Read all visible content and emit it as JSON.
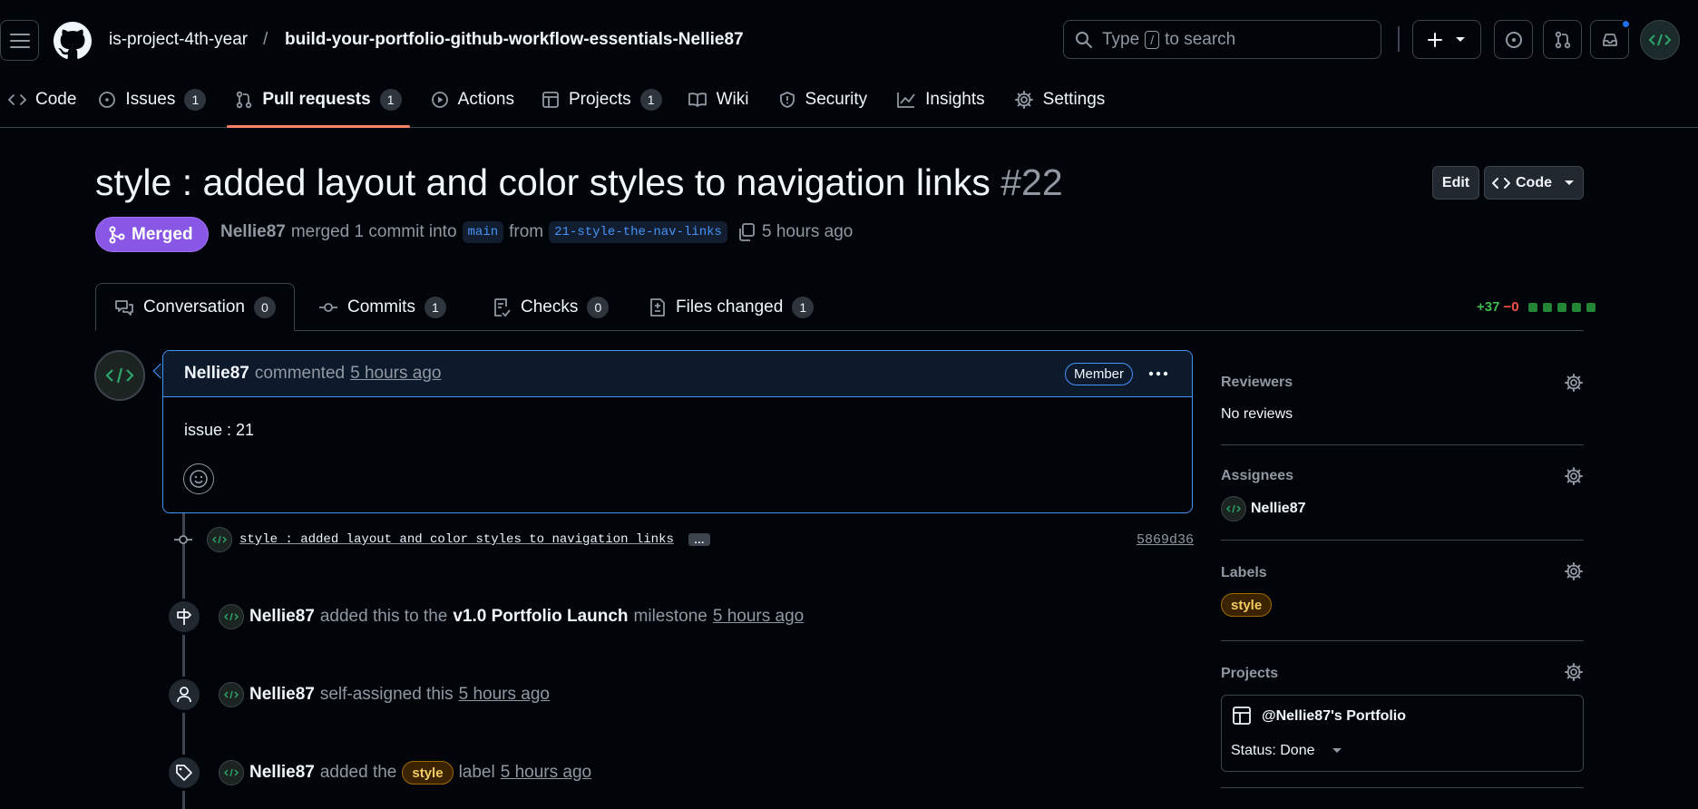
{
  "header": {
    "owner": "is-project-4th-year",
    "separator": "/",
    "repo": "build-your-portfolio-github-workflow-essentials-Nellie87",
    "search_prefix": "Type",
    "search_key": "/",
    "search_suffix": "to search"
  },
  "repo_tabs": [
    {
      "label": "Code",
      "icon": "code-icon",
      "count": null
    },
    {
      "label": "Issues",
      "icon": "issue-icon",
      "count": "1"
    },
    {
      "label": "Pull requests",
      "icon": "pull-request-icon",
      "count": "1",
      "active": true
    },
    {
      "label": "Actions",
      "icon": "play-icon",
      "count": null
    },
    {
      "label": "Projects",
      "icon": "table-icon",
      "count": "1"
    },
    {
      "label": "Wiki",
      "icon": "book-icon",
      "count": null
    },
    {
      "label": "Security",
      "icon": "shield-icon",
      "count": null
    },
    {
      "label": "Insights",
      "icon": "graph-icon",
      "count": null
    },
    {
      "label": "Settings",
      "icon": "gear-icon",
      "count": null
    }
  ],
  "pr": {
    "title": "style : added layout and color styles to navigation links",
    "number": "#22",
    "status": "Merged",
    "author": "Nellie87",
    "merged_text": "merged 1 commit into",
    "base_branch": "main",
    "from_text": "from",
    "head_branch": "21-style-the-nav-links",
    "time": "5 hours ago",
    "edit_label": "Edit",
    "code_label": "Code"
  },
  "pr_tabs": [
    {
      "label": "Conversation",
      "icon": "comment-icon",
      "count": "0"
    },
    {
      "label": "Commits",
      "icon": "commit-icon",
      "count": "1"
    },
    {
      "label": "Checks",
      "icon": "checklist-icon",
      "count": "0"
    },
    {
      "label": "Files changed",
      "icon": "file-diff-icon",
      "count": "1"
    }
  ],
  "diffstat": {
    "additions": "+37",
    "deletions": "−0",
    "blocks": 5
  },
  "comment": {
    "author": "Nellie87",
    "action": "commented",
    "time": "5 hours ago",
    "badge": "Member",
    "body": "issue : 21"
  },
  "commit": {
    "message": "style : added layout and color styles to navigation links",
    "ellipsis": "…",
    "sha": "5869d36"
  },
  "events": [
    {
      "author": "Nellie87",
      "pre": "added this to the",
      "strong": "v1.0 Portfolio Launch",
      "post": "milestone",
      "time": "5 hours ago"
    },
    {
      "author": "Nellie87",
      "pre": "self-assigned this",
      "time": "5 hours ago"
    },
    {
      "author": "Nellie87",
      "pre": "added the",
      "label": "style",
      "post": "label",
      "time": "5 hours ago"
    }
  ],
  "sidebar": {
    "reviewers": {
      "title": "Reviewers",
      "value": "No reviews"
    },
    "assignees": {
      "title": "Assignees",
      "value": "Nellie87"
    },
    "labels": {
      "title": "Labels",
      "value": "style"
    },
    "projects": {
      "title": "Projects",
      "project_name": "@Nellie87's Portfolio",
      "status": "Status: Done"
    }
  },
  "colors": {
    "merged": "#8957e5",
    "accent": "#4493f8",
    "label_bg": "#3b2300",
    "label_fg": "#f2cc60"
  }
}
